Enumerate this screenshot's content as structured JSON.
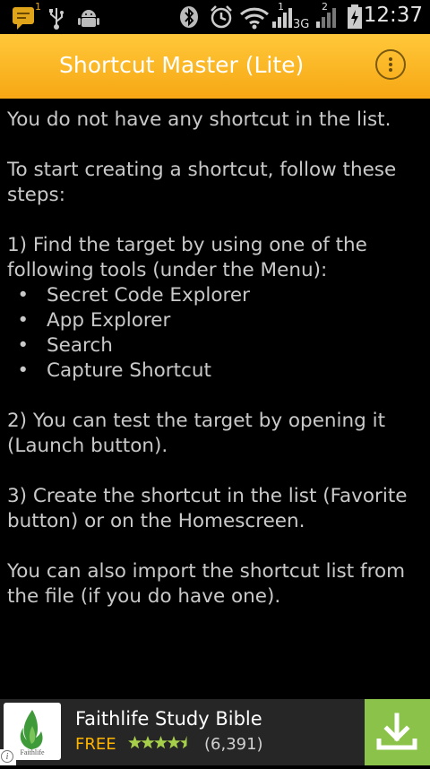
{
  "status_bar": {
    "time": "12:37",
    "notification_count": "1",
    "network_type": "3G",
    "sim1_label": "1",
    "sim2_label": "2",
    "icons": [
      "message-icon",
      "usb-icon",
      "android-icon",
      "bluetooth-icon",
      "alarm-icon",
      "wifi-icon",
      "signal-icon",
      "signal-icon",
      "battery-icon"
    ]
  },
  "app_bar": {
    "title": "Shortcut Master (Lite)",
    "overflow_icon": "more-vert-icon",
    "color": "#f9b11c"
  },
  "content": {
    "empty_message": "You do not have any shortcut in the list.",
    "intro": "To start creating a shortcut, follow these steps:",
    "step1": "1) Find the target by using one of the following tools (under the Menu):",
    "tools": [
      "Secret Code Explorer",
      "App Explorer",
      "Search",
      "Capture Shortcut"
    ],
    "step2": "2) You can test the target by opening it (Launch button).",
    "step3": "3) Create the shortcut in the list (Favorite button) or on the Homescreen.",
    "import_note": "You can also import the shortcut list from the file (if you do have one)."
  },
  "ad": {
    "app_name": "Faithlife Study Bible",
    "logo_text": "Faithlife",
    "price": "FREE",
    "rating": 4.5,
    "rating_count": "(6,391)",
    "info_icon": "info-icon",
    "download_icon": "download-icon",
    "accent": "#8bc34a"
  }
}
